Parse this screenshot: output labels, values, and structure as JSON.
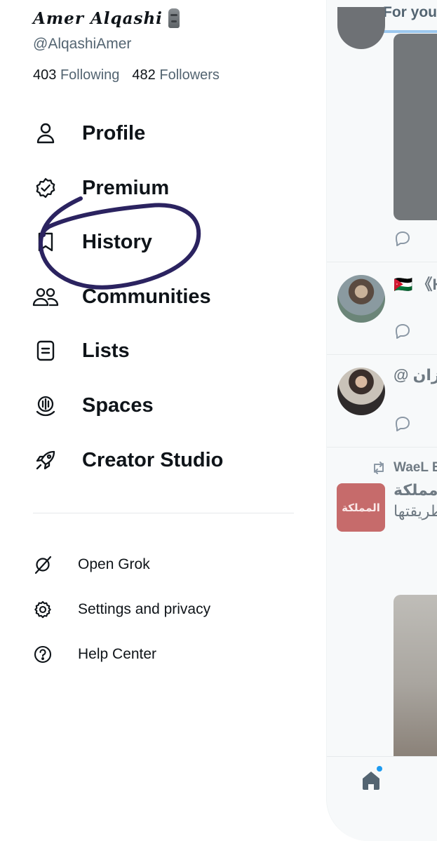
{
  "profile": {
    "display_name": "𝑨𝒎𝒆𝒓 𝑨𝒍𝒒𝒂𝒔𝒉𝒊",
    "emoji_icon": "moai-icon",
    "handle": "@AlqashiAmer",
    "following_count": "403",
    "following_label": "Following",
    "followers_count": "482",
    "followers_label": "Followers"
  },
  "menu": {
    "primary": [
      {
        "label": "Profile",
        "icon": "person-icon"
      },
      {
        "label": "Premium",
        "icon": "verified-badge-icon"
      },
      {
        "label": "History",
        "icon": "bookmark-icon"
      },
      {
        "label": "Communities",
        "icon": "people-icon"
      },
      {
        "label": "Lists",
        "icon": "list-icon"
      },
      {
        "label": "Spaces",
        "icon": "microphone-icon"
      },
      {
        "label": "Creator Studio",
        "icon": "rocket-icon"
      }
    ],
    "secondary": [
      {
        "label": "Open Grok",
        "icon": "grok-icon"
      },
      {
        "label": "Settings and privacy",
        "icon": "gear-icon"
      },
      {
        "label": "Help Center",
        "icon": "help-icon"
      }
    ]
  },
  "annotation": {
    "color": "#2b2360",
    "target": "History"
  },
  "timeline": {
    "tab_label": "For you",
    "tweet1_name": "🇯🇴 《H",
    "tweet2_name": "@ رزان",
    "retweet_label": "WaeL B",
    "tweet3_line1": "مملكة",
    "tweet3_line2": "طريقتها",
    "news_logo_text": "المملكة",
    "nav_icon": "home-icon"
  },
  "colors": {
    "text_primary": "#0f1419",
    "text_secondary": "#536471",
    "accent": "#1d9bf0",
    "news_logo_bg": "#c66b6b"
  }
}
